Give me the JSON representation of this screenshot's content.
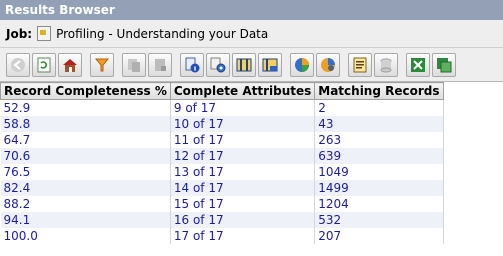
{
  "window": {
    "title": "Results Browser"
  },
  "job": {
    "label": "Job:",
    "name": "Profiling - Understanding your Data"
  },
  "toolbar": {
    "buttons": [
      {
        "icon": "back-icon"
      },
      {
        "icon": "refresh-icon"
      },
      {
        "icon": "home-icon"
      },
      {
        "icon": "filter-icon"
      },
      {
        "icon": "copy-icon"
      },
      {
        "icon": "paste-icon"
      },
      {
        "icon": "info-icon"
      },
      {
        "icon": "settings-icon"
      },
      {
        "icon": "columns-icon"
      },
      {
        "icon": "save-columns-icon"
      },
      {
        "icon": "pie-chart-icon"
      },
      {
        "icon": "pie-chart-settings-icon"
      },
      {
        "icon": "report-icon"
      },
      {
        "icon": "database-icon"
      },
      {
        "icon": "excel-icon"
      },
      {
        "icon": "excel-export-icon"
      }
    ]
  },
  "table": {
    "headers": [
      "Record Completeness %",
      "Complete Attributes",
      "Matching Records"
    ],
    "rows": [
      [
        "52.9",
        "9 of 17",
        "2"
      ],
      [
        "58.8",
        "10 of 17",
        "43"
      ],
      [
        "64.7",
        "11 of 17",
        "263"
      ],
      [
        "70.6",
        "12 of 17",
        "639"
      ],
      [
        "76.5",
        "13 of 17",
        "1049"
      ],
      [
        "82.4",
        "14 of 17",
        "1499"
      ],
      [
        "88.2",
        "15 of 17",
        "1204"
      ],
      [
        "94.1",
        "16 of 17",
        "532"
      ],
      [
        "100.0",
        "17 of 17",
        "207"
      ]
    ]
  },
  "colors": {
    "titlebar": "#94a0b5",
    "cell_text": "#1b1ba8",
    "row_alt": "#eef1f8"
  }
}
